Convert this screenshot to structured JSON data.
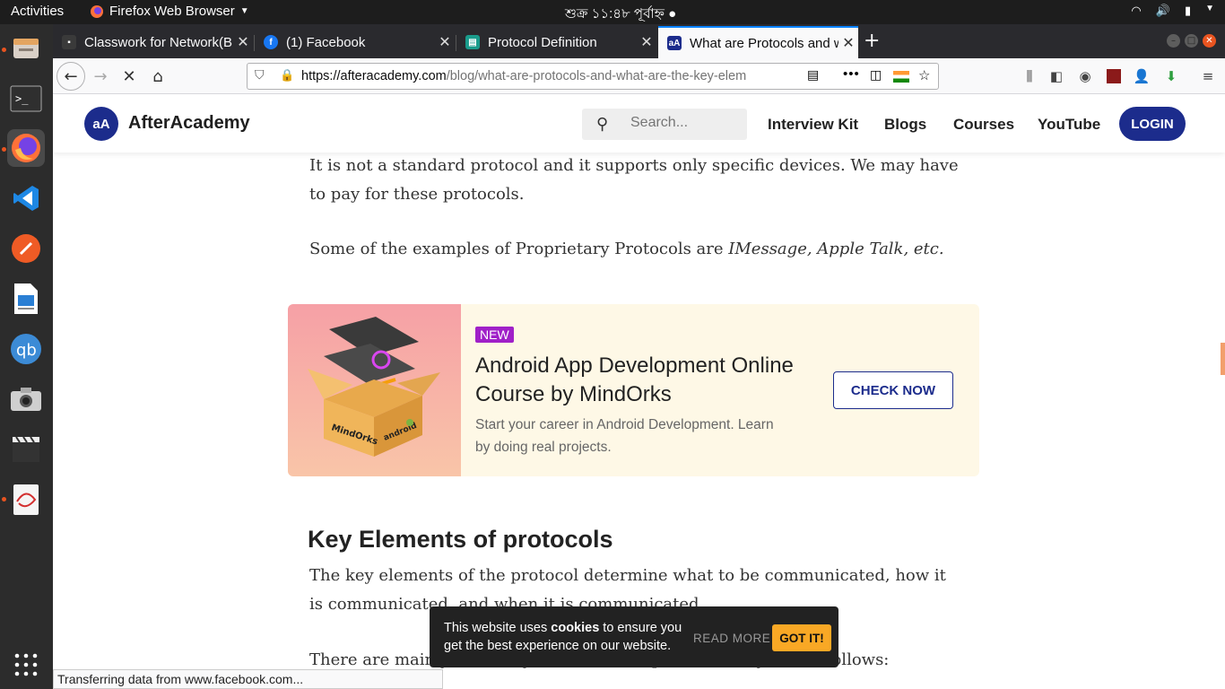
{
  "system": {
    "activities": "Activities",
    "app_menu": "Firefox Web Browser",
    "clock": "শুক্র ১১:৪৮ পূর্বাহ্ন ●"
  },
  "browser": {
    "tabs": [
      {
        "title": "Classwork for Network(B",
        "icon": "google-classroom-icon"
      },
      {
        "title": "(1) Facebook",
        "icon": "facebook-icon"
      },
      {
        "title": "Protocol Definition",
        "icon": "book-icon"
      },
      {
        "title": "What are Protocols and w",
        "icon": "afteracademy-icon",
        "active": true
      }
    ],
    "url_domain": "https://afteracademy.com",
    "url_path": "/blog/what-are-protocols-and-what-are-the-key-elem",
    "status": "Transferring data from www.facebook.com..."
  },
  "site": {
    "brand": "AfterAcademy",
    "logo_text": "aA",
    "search_placeholder": "Search...",
    "nav": [
      "Interview Kit",
      "Blogs",
      "Courses",
      "YouTube"
    ],
    "login": "LOGIN"
  },
  "article": {
    "para1": "It is not a standard protocol and it supports only specific devices. We may have to pay for these protocols.",
    "para2_prefix": "Some of the examples of Proprietary Protocols are ",
    "para2_italic": "IMessage, Apple Talk, etc.",
    "heading": "Key Elements of protocols",
    "para3": "The key elements of the protocol determine what to be communicated, how it is communicated, and when it is communicated.",
    "para4": "There are mainly three key elements of a protocol, they are as follows:"
  },
  "promo": {
    "badge": "NEW",
    "title": "Android App Development Online Course by MindOrks",
    "description": "Start your career in Android Development. Learn by doing real projects.",
    "button": "CHECK NOW",
    "box_label1": "MindOrks",
    "box_label2": "android"
  },
  "cookie": {
    "msg_prefix": "This website uses ",
    "msg_bold": "cookies",
    "msg_suffix": " to ensure you get the best experience on our website.",
    "read_more": "READ MORE",
    "got_it": "GOT IT!"
  },
  "colors": {
    "brand": "#1c2c8c",
    "accent": "#f9a825",
    "badge": "#a020c8"
  }
}
